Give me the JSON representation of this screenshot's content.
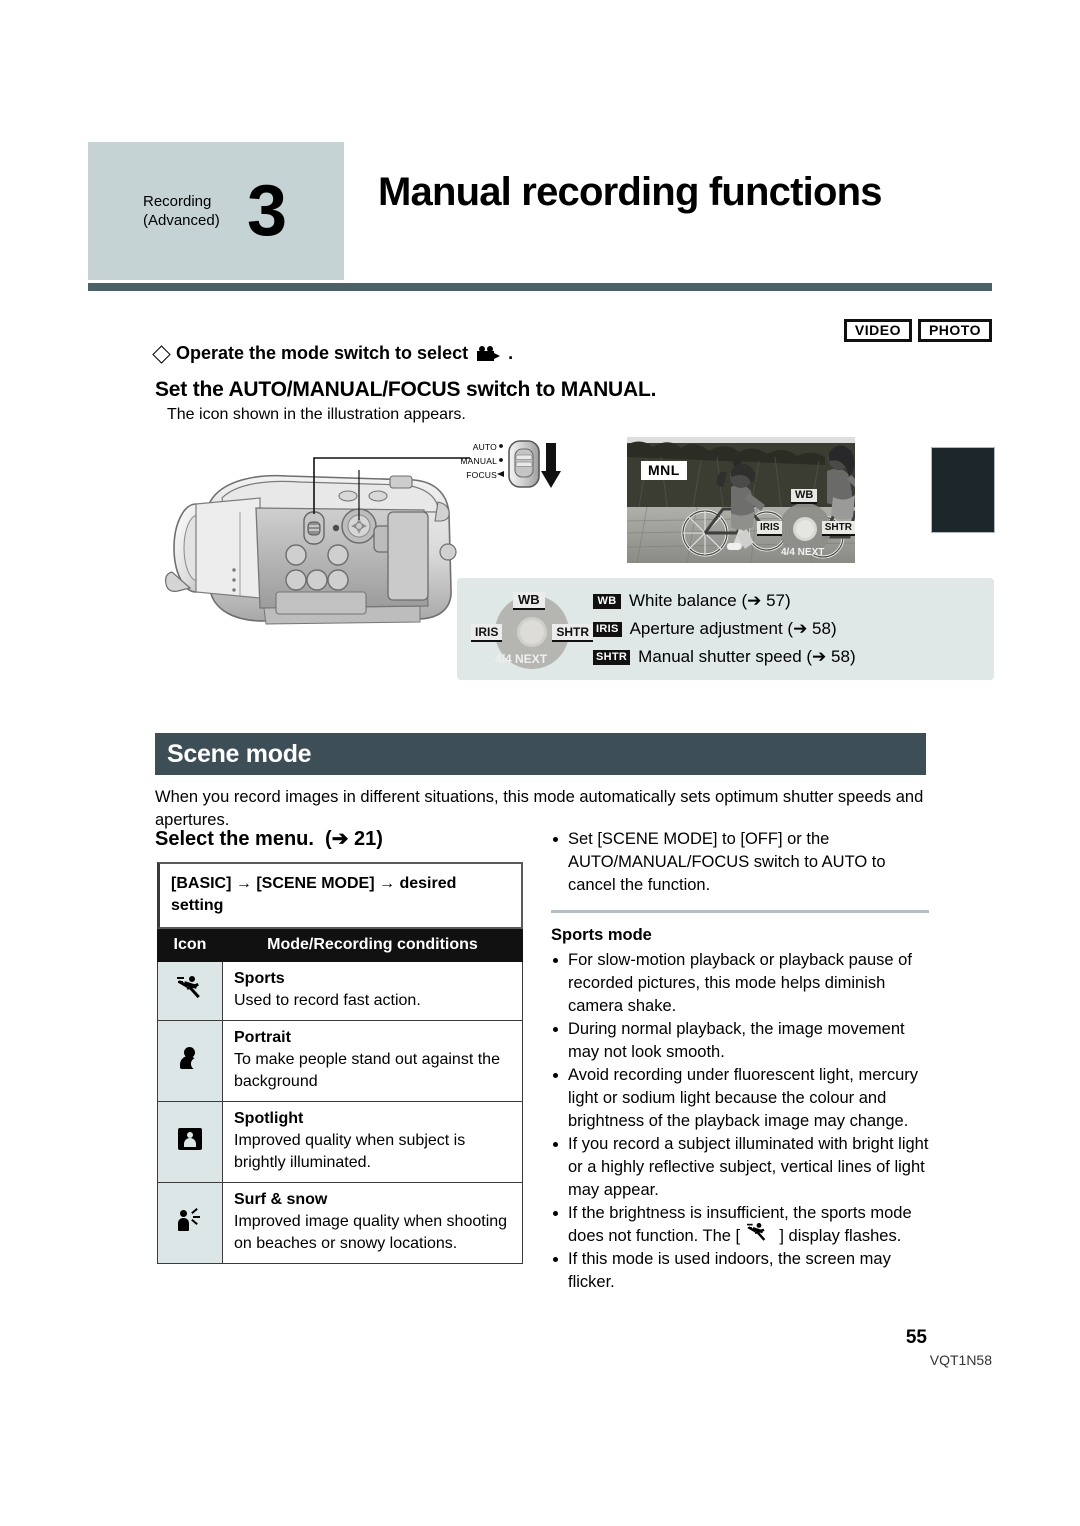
{
  "header": {
    "kicker_line1": "Recording",
    "kicker_line2": "(Advanced)",
    "chapter_number": "3",
    "title": "Manual recording functions",
    "band_color": "#c5d3d5",
    "rule_color": "#4c6068"
  },
  "media_badges": [
    {
      "label": "VIDEO"
    },
    {
      "label": "PHOTO"
    }
  ],
  "step": {
    "operate_line": "Operate the mode switch to select",
    "operate_trailing": ".",
    "camera_icon": "video-camera-icon",
    "heading": "Set the AUTO/MANUAL/FOCUS switch to MANUAL.",
    "subtext": "The icon shown in the illustration appears."
  },
  "switch_callout": {
    "labels": [
      "AUTO",
      "MANUAL",
      "FOCUS"
    ],
    "arrow_icon": "down-arrow-icon"
  },
  "lcd": {
    "mode_badge": "MNL",
    "joystick": {
      "up": "WB",
      "left": "IRIS",
      "right": "SHTR",
      "down": "4/4 NEXT"
    }
  },
  "legend": {
    "joystick": {
      "up": "WB",
      "left": "IRIS",
      "right": "SHTR",
      "down": "4/4 NEXT"
    },
    "items": [
      {
        "tag": "WB",
        "text": "White balance",
        "ref": "57"
      },
      {
        "tag": "IRIS",
        "text": "Aperture adjustment",
        "ref": "58"
      },
      {
        "tag": "SHTR",
        "text": "Manual shutter speed",
        "ref": "58"
      }
    ],
    "background": "#dfe7e7"
  },
  "section": {
    "title": "Scene mode",
    "bar_color": "#3e4e56",
    "intro": "When you record images in different situations, this mode automatically sets optimum shutter speeds and apertures."
  },
  "left_column": {
    "select_menu_heading": "Select the menu.",
    "select_menu_ref": "21",
    "menu_path": "[BASIC] → [SCENE MODE] → desired setting",
    "table": {
      "columns": [
        "Icon",
        "Mode/Recording conditions"
      ],
      "rows": [
        {
          "icon": "sports-runner-icon",
          "name": "Sports",
          "desc": "Used to record fast action."
        },
        {
          "icon": "portrait-person-icon",
          "name": "Portrait",
          "desc": "To make people stand out against the background"
        },
        {
          "icon": "spotlight-icon",
          "name": "Spotlight",
          "desc": "Improved quality when subject is brightly illuminated."
        },
        {
          "icon": "surf-and-snow-icon",
          "name": "Surf & snow",
          "desc": "Improved image quality when shooting on beaches or snowy locations."
        }
      ]
    }
  },
  "right_column": {
    "top_bullets": [
      "Set [SCENE MODE] to [OFF] or the AUTO/MANUAL/FOCUS switch to AUTO to cancel the function."
    ],
    "sports_mode_heading": "Sports mode",
    "sports_bullets_before_icon": [
      "For slow-motion playback or playback pause of recorded pictures, this mode helps diminish camera shake.",
      "During normal playback, the image movement may not look smooth.",
      "Avoid recording under fluorescent light, mercury light or sodium light because the colour and brightness of the playback image may change.",
      "If you record a subject illuminated with bright light or a highly reflective subject, vertical lines of light may appear."
    ],
    "icon_bullet_prefix": "If the brightness is insufficient, the sports mode does not function. The [",
    "icon_bullet_suffix": "] display flashes.",
    "sports_bullets_after_icon": [
      "If this mode is used indoors, the screen may flicker."
    ]
  },
  "footer": {
    "page_number": "55",
    "doc_code": "VQT1N58"
  }
}
